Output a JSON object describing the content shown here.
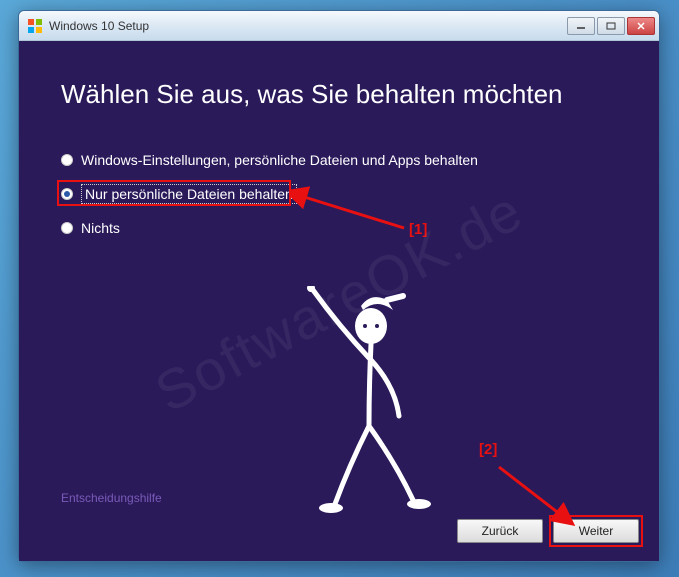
{
  "window": {
    "title": "Windows 10 Setup"
  },
  "heading": "Wählen Sie aus, was Sie behalten möchten",
  "options": [
    {
      "label": "Windows-Einstellungen, persönliche Dateien und Apps behalten",
      "checked": false
    },
    {
      "label": "Nur persönliche Dateien behalten",
      "checked": true
    },
    {
      "label": "Nichts",
      "checked": false
    }
  ],
  "help_link": "Entscheidungshilfe",
  "buttons": {
    "back": "Zurück",
    "next": "Weiter"
  },
  "annotations": {
    "label1": "[1]",
    "label2": "[2]"
  },
  "watermark": "SoftwareOK.de"
}
